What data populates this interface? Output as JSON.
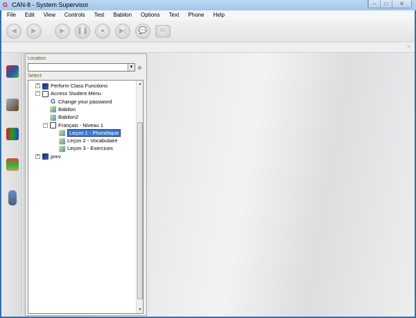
{
  "window": {
    "title": "CAN-8 - System Supervisor",
    "logo": "G"
  },
  "menu": [
    "File",
    "Edit",
    "View",
    "Controls",
    "Test",
    "Babilon",
    "Options",
    "Text",
    "Phone",
    "Help"
  ],
  "toolbar": [
    "back-icon",
    "forward-icon",
    "play-icon",
    "pause-icon",
    "record-icon",
    "skip-icon",
    "speech-icon",
    "mail-icon"
  ],
  "panel": {
    "location_label": "Location",
    "location_value": "",
    "select_label": "Select:"
  },
  "tree": [
    {
      "label": "Perform Class Functions",
      "level": 0,
      "icon": "book"
    },
    {
      "label": "Access Student Menu",
      "level": 0,
      "icon": "open"
    },
    {
      "label": "Change your password",
      "level": 1,
      "icon": "g"
    },
    {
      "label": "Babilon",
      "level": 1,
      "icon": "page"
    },
    {
      "label": "Babilon2",
      "level": 1,
      "icon": "page"
    },
    {
      "label": "Français - Niveau 1",
      "level": 1,
      "icon": "open"
    },
    {
      "label": "Leçon 1 - Phonétique",
      "level": 2,
      "icon": "page",
      "selected": true
    },
    {
      "label": "Leçon 2 - Vocabulaire",
      "level": 2,
      "icon": "page"
    },
    {
      "label": "Leçon 3 - Exercices",
      "level": 2,
      "icon": "page"
    },
    {
      "label": "prev",
      "level": 0,
      "icon": "book"
    }
  ]
}
